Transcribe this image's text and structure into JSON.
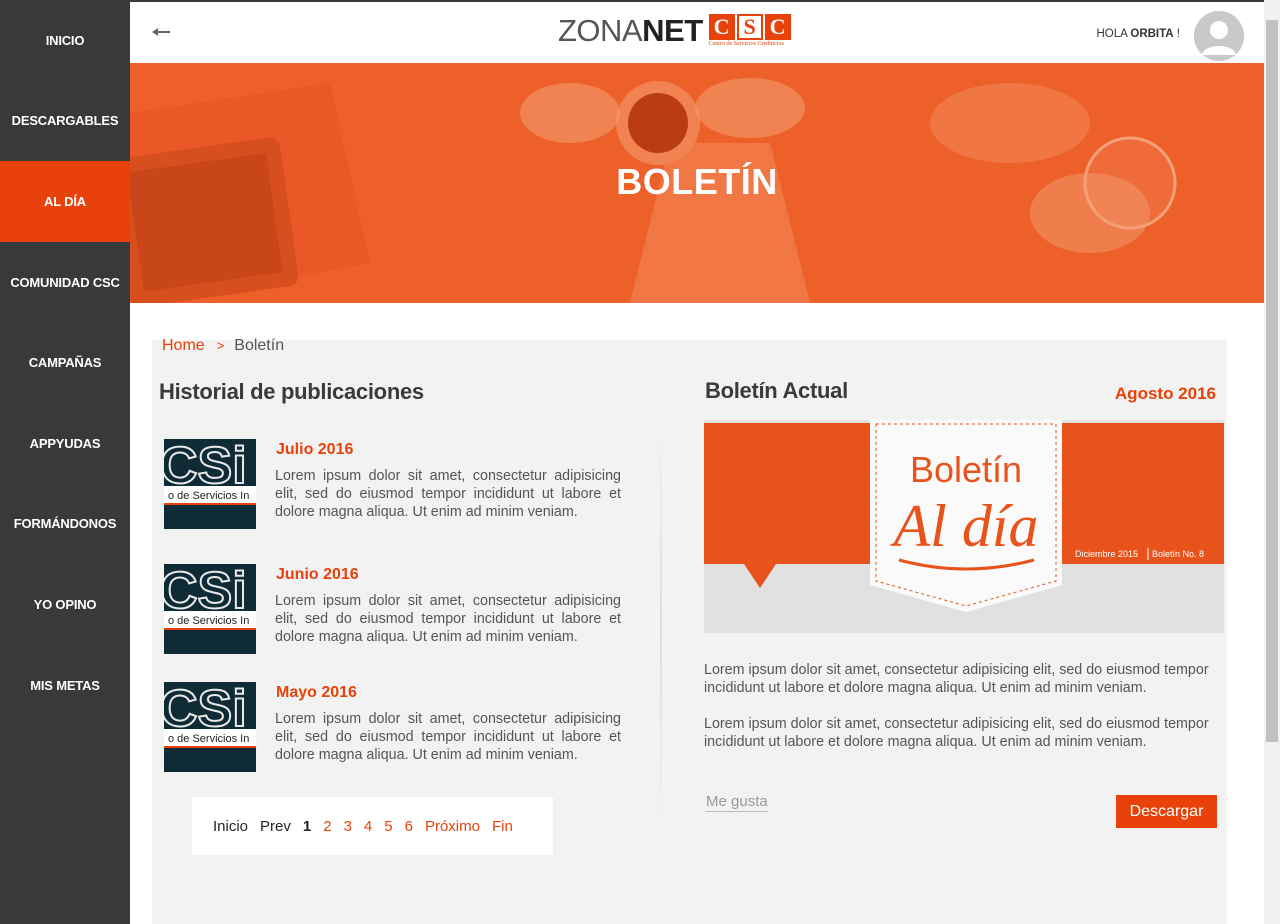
{
  "sidebar": {
    "items": [
      {
        "label": "INICIO"
      },
      {
        "label": "DESCARGABLES"
      },
      {
        "label": "AL DÍA"
      },
      {
        "label": "COMUNIDAD CSC"
      },
      {
        "label": "CAMPAÑAS"
      },
      {
        "label": "APPYUDAS"
      },
      {
        "label": "FORMÁNDONOS"
      },
      {
        "label": "YO OPINO"
      },
      {
        "label": "MIS METAS"
      }
    ],
    "active_index": 2
  },
  "header": {
    "logo_zona": "ZONA",
    "logo_net": "NET",
    "logo_csc_letters": [
      "C",
      "S",
      "C"
    ],
    "logo_csc_subtitle": "Centro de Servicios Crediticios",
    "greeting_prefix": "HOLA ",
    "greeting_name": "ORBITA",
    "greeting_suffix": " !"
  },
  "hero": {
    "title": "BOLETÍN"
  },
  "breadcrumb": {
    "home": "Home",
    "separator": ">",
    "current": "Boletín"
  },
  "history": {
    "title": "Historial de publicaciones",
    "thumb_text": "CSi",
    "thumb_caption": "o de Servicios In",
    "items": [
      {
        "title": "Julio 2016",
        "text": "Lorem ipsum dolor sit amet, consectetur adipisicing elit, sed do eiusmod tempor incididunt ut labore et dolore magna aliqua. Ut enim ad minim veniam."
      },
      {
        "title": "Junio 2016",
        "text": "Lorem ipsum dolor sit amet, consectetur adipisicing elit, sed do eiusmod tempor incididunt ut labore et dolore magna aliqua. Ut enim ad minim veniam."
      },
      {
        "title": "Mayo 2016",
        "text": "Lorem ipsum dolor sit amet, consectetur adipisicing elit, sed do eiusmod tempor incididunt ut labore et dolore magna aliqua. Ut enim ad minim veniam."
      }
    ]
  },
  "pagination": {
    "first": "Inicio",
    "prev": "Prev",
    "pages": [
      "1",
      "2",
      "3",
      "4",
      "5",
      "6"
    ],
    "current": "1",
    "next": "Próximo",
    "last": "Fin"
  },
  "current": {
    "title": "Boletín Actual",
    "date": "Agosto 2016",
    "cover_title_1": "Boletín",
    "cover_title_2": "Al día",
    "cover_date": "Diciembre 2015",
    "cover_issue": "Boletín No. 8",
    "paragraphs": [
      "Lorem ipsum dolor sit amet, consectetur adipisicing elit, sed do eiusmod tempor incididunt ut labore et dolore magna aliqua. Ut enim ad minim veniam.",
      "Lorem ipsum dolor sit amet, consectetur adipisicing elit, sed do eiusmod tempor incididunt ut labore et dolore magna aliqua. Ut enim ad minim veniam."
    ],
    "like_label": "Me gusta",
    "download_label": "Descargar"
  },
  "colors": {
    "accent": "#e8410a",
    "sidebar": "#37393a",
    "hero": "#ec5a24"
  }
}
